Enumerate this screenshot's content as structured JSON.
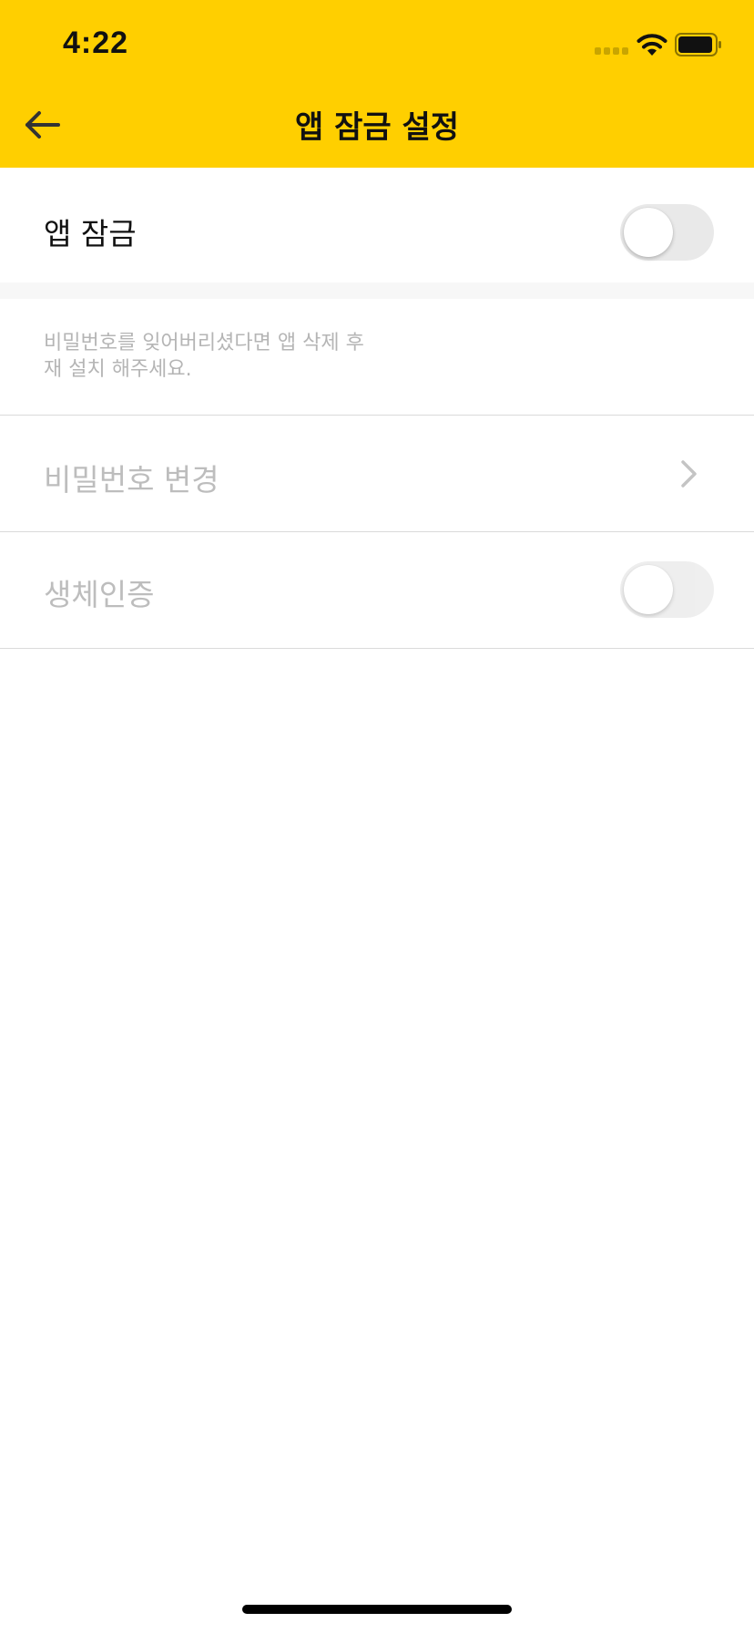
{
  "status_bar": {
    "time": "4:22",
    "icons": [
      "cellular-signal-icon",
      "wifi-icon",
      "battery-icon"
    ]
  },
  "nav": {
    "title": "앱 잠금 설정",
    "back_icon": "arrow-left-icon"
  },
  "settings": {
    "app_lock": {
      "label": "앱 잠금",
      "enabled": false
    },
    "notice_lines": [
      "비밀번호를 잊어버리셨다면 앱 삭제 후",
      "재 설치 해주세요."
    ],
    "change_password": {
      "label": "비밀번호 변경",
      "icon": "chevron-right-icon"
    },
    "biometric": {
      "label": "생체인증",
      "enabled": false
    }
  },
  "colors": {
    "header_background": "#FFCF00",
    "toggle_off": "#E9E9E9",
    "disabled_text": "#BDBDBD",
    "divider": "#DADADA"
  }
}
